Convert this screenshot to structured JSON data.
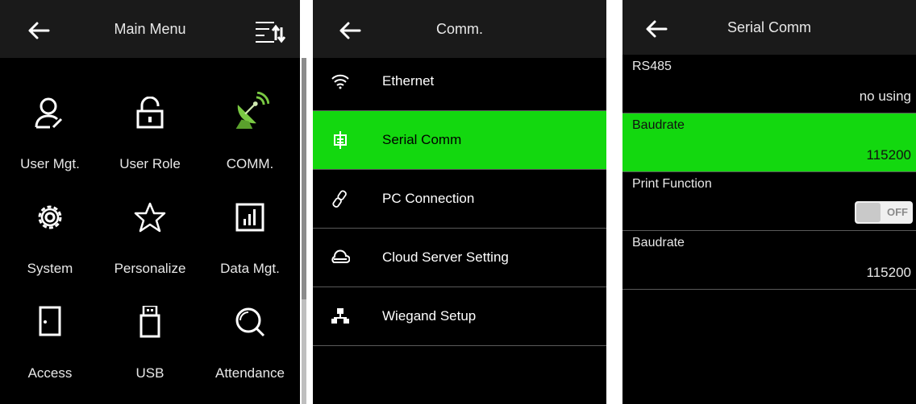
{
  "colors": {
    "accent": "#13d80f",
    "header_bg": "#1a1a1a",
    "panel_bg": "#000000"
  },
  "main_menu": {
    "title": "Main Menu",
    "items": [
      {
        "label": "User Mgt.",
        "icon": "user-icon"
      },
      {
        "label": "User Role",
        "icon": "lock-icon"
      },
      {
        "label": "COMM.",
        "icon": "satellite-dish-icon"
      },
      {
        "label": "System",
        "icon": "gear-icon"
      },
      {
        "label": "Personalize",
        "icon": "star-icon"
      },
      {
        "label": "Data Mgt.",
        "icon": "bar-chart-icon"
      },
      {
        "label": "Access",
        "icon": "door-icon"
      },
      {
        "label": "USB",
        "icon": "usb-icon"
      },
      {
        "label": "Attendance",
        "icon": "magnifier-icon"
      }
    ]
  },
  "comm": {
    "title": "Comm.",
    "items": [
      {
        "label": "Ethernet",
        "icon": "wifi-icon"
      },
      {
        "label": "Serial Comm",
        "icon": "serial-port-icon",
        "selected": true
      },
      {
        "label": "PC Connection",
        "icon": "link-icon"
      },
      {
        "label": "Cloud Server Setting",
        "icon": "cloud-icon"
      },
      {
        "label": "Wiegand Setup",
        "icon": "network-icon"
      }
    ]
  },
  "serial": {
    "title": "Serial Comm",
    "rows": [
      {
        "name": "RS485",
        "value": "no using"
      },
      {
        "name": "Baudrate",
        "value": "115200",
        "selected": true
      },
      {
        "name": "Print Function",
        "toggle": "OFF"
      },
      {
        "name": "Baudrate",
        "value": "115200"
      }
    ]
  }
}
